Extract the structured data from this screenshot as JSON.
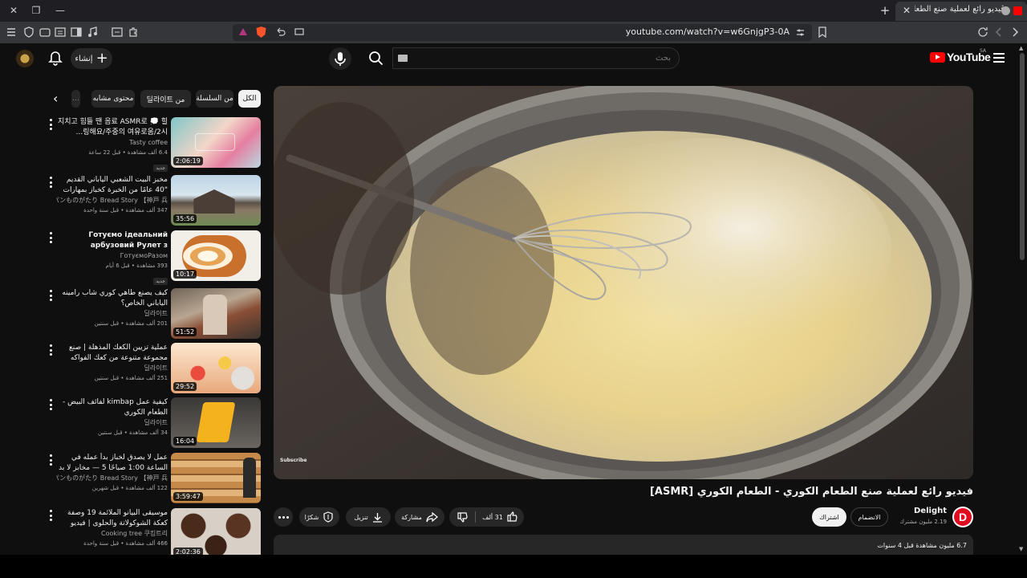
{
  "browser": {
    "tab_title": "ڤيديو رائع لعملية صنع الطعام ال",
    "url": "youtube.com/watch?v=w6GnjgP3-0A"
  },
  "header": {
    "create_label": "إنشاء",
    "search_placeholder": "بحث",
    "logo_text": "YouTube",
    "logo_country": "SA"
  },
  "chips": [
    "الكل",
    "من السلسلة",
    "딜라이트 من",
    "محتوى مشابه"
  ],
  "videos": [
    {
      "title": "지치고 힘들 땐 음료 ASMR로 💭 힐링해요/주중의 여유로움/2시...",
      "channel": "Tasty coffee",
      "meta": "6.4 ألف مشاهدة • قبل 22 ساعة",
      "badge": "جديد",
      "duration": "2:06:19"
    },
    {
      "title": "مخبز البيت الشعبي الياباني القديم \"40 عامًا من الخبرة كخباز بمهارات مذهلة",
      "channel": "パンものがたり Bread Story 【神戸 兵...",
      "meta": "347 ألف مشاهدة • قبل سنة واحدة",
      "badge": "",
      "duration": "35:56"
    },
    {
      "title": "Готуємо ідеальний арбузовий Рулет з начинкою...",
      "channel": "ГотуємоРазом",
      "meta": "393 مشاهدة • قبل 6 أيام",
      "badge": "جديد",
      "duration": "10:17"
    },
    {
      "title": "كيف يصنع طاهي كوري شاب رامينه الياباني الخاص؟",
      "channel": "딜라이트",
      "meta": "201 ألف مشاهدة • قبل سنتين",
      "badge": "",
      "duration": "51:52"
    },
    {
      "title": "عملية تزيين الكعك المذهلة | صنع مجموعة متنوعة من كعك الفواكه الطازجة المحتويات...",
      "channel": "딜라이트",
      "meta": "251 ألف مشاهدة • قبل سنتين",
      "badge": "",
      "duration": "29:52"
    },
    {
      "title": "كيفية عمل kimbap لفائف البيض - الطعام الكوري",
      "channel": "딜라이트",
      "meta": "34 ألف مشاهدة • قبل سنتين",
      "badge": "",
      "duration": "16:04"
    },
    {
      "title": "عمل لا يصدق لخباز بدأ عمله في الساعة 1:00 صباحًا 5 — مخابز لا بد من زيارتها...",
      "channel": "パンものがたり Bread Story 【神戸 兵...",
      "meta": "122 ألف مشاهدة • قبل شهرين",
      "badge": "",
      "duration": "3:59:47"
    },
    {
      "title": "موسيقى البيانو الملائمة 19 وصفة كعكة الشوكولاتة والحلوى | فيديو الخبز | كعكة الج...",
      "channel": "Cooking tree 쿠킹트리",
      "meta": "466 ألف مشاهدة • قبل سنة واحدة",
      "badge": "",
      "duration": "2:02:36"
    }
  ],
  "player": {
    "watermark": "Subscribe"
  },
  "video": {
    "title": "فيديو رائع لعملية صنع الطعام الكوري - الطعام الكوري [ASMR]",
    "channel_name": "Delight",
    "channel_initial": "D",
    "subscribers": "2.19 مليون مشترك",
    "join_label": "الانضمام",
    "subscribe_label": "اشتراك",
    "likes": "31 ألف",
    "share_label": "مشاركة",
    "download_label": "تنزيل",
    "thanks_label": "شكرًا",
    "views_meta": "6.7 مليون مشاهدة قبل 4 سنوات"
  },
  "colors": {
    "accent": "#ff0000",
    "background": "#0f0f0f",
    "pill": "#272727"
  }
}
